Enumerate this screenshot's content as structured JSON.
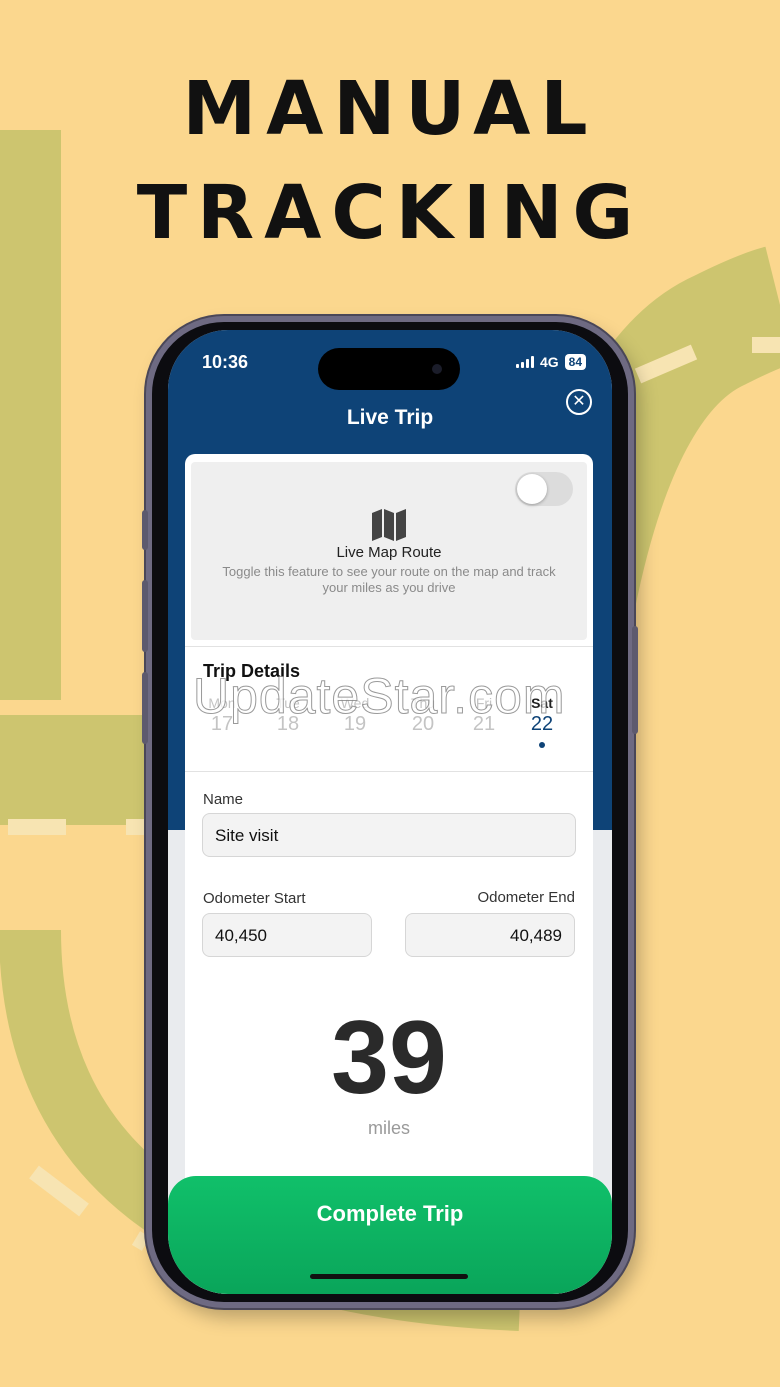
{
  "poster": {
    "headline_line1": "MANUAL",
    "headline_line2": "TRACKING"
  },
  "status_bar": {
    "time": "10:36",
    "network": "4G",
    "battery": "84"
  },
  "nav": {
    "title": "Live Trip"
  },
  "map_route": {
    "title": "Live Map Route",
    "description": "Toggle this feature to see your route on the map and track your miles as you drive",
    "toggle_on": false
  },
  "trip_details": {
    "title": "Trip Details",
    "days": [
      {
        "name": "Mon",
        "date": "17",
        "selected": false,
        "dot": false
      },
      {
        "name": "Tue",
        "date": "18",
        "selected": false,
        "dot": false
      },
      {
        "name": "Wed",
        "date": "19",
        "selected": false,
        "dot": false
      },
      {
        "name": "Thu",
        "date": "20",
        "selected": false,
        "dot": false
      },
      {
        "name": "Fri",
        "date": "21",
        "selected": false,
        "dot": false
      },
      {
        "name": "Sat",
        "date": "22",
        "selected": true,
        "dot": true
      }
    ]
  },
  "form": {
    "name_label": "Name",
    "name_value": "Site visit",
    "odometer_start_label": "Odometer Start",
    "odometer_start_value": "40,450",
    "odometer_end_label": "Odometer End",
    "odometer_end_value": "40,489"
  },
  "distance": {
    "value": "39",
    "unit": "miles"
  },
  "actions": {
    "complete_label": "Complete Trip"
  },
  "watermark": "UpdateStar.com",
  "colors": {
    "background": "#fbd78e",
    "road": "#cdc56f",
    "header": "#0e4377",
    "accent": "#10c06a"
  }
}
